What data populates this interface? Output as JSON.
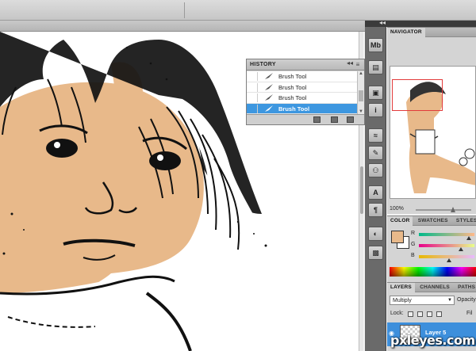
{
  "history": {
    "title": "HISTORY",
    "menu_icon": "panel-menu-icon",
    "items": [
      {
        "label": "Brush Tool"
      },
      {
        "label": "Brush Tool"
      },
      {
        "label": "Brush Tool"
      },
      {
        "label": "Brush Tool",
        "selected": true
      }
    ]
  },
  "navigator": {
    "tab": "NAVIGATOR",
    "zoom": "100%"
  },
  "color_panel": {
    "tabs": [
      "COLOR",
      "SWATCHES",
      "STYLES"
    ],
    "foreground": "#e8b98a",
    "background": "#ffffff",
    "channels": [
      "R",
      "G",
      "B"
    ]
  },
  "layers_panel": {
    "tabs": [
      "LAYERS",
      "CHANNELS",
      "PATHS"
    ],
    "blend_mode": "Multiply",
    "opacity_label": "Opacity",
    "lock_label": "Lock:",
    "fill_label": "Fil",
    "layer_name": "Layer 5"
  },
  "dock": {
    "icons": [
      "mini-bridge-icon",
      "history-icon",
      "navigator-icon",
      "info-icon",
      "adjustments-icon",
      "brush-presets-icon",
      "clone-source-icon",
      "character-icon",
      "paragraph-icon",
      "tool-presets-icon",
      "masks-icon"
    ]
  },
  "watermark": "pxleyes.com"
}
